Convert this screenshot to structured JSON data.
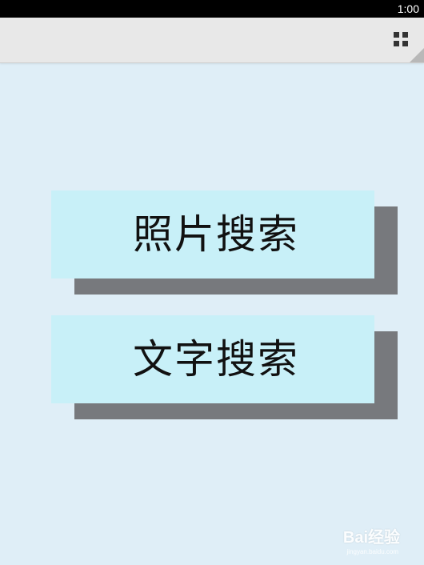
{
  "status_bar": {
    "time": "1:00"
  },
  "action_bar": {
    "menu_icon": "grid-menu-icon"
  },
  "buttons": [
    {
      "label": "照片搜索"
    },
    {
      "label": "文字搜索"
    }
  ],
  "watermark": {
    "text": "Bai经验",
    "subtext": "jingyan.baidu.com"
  },
  "colors": {
    "background": "#dfeef7",
    "button_face": "#c8f0f8",
    "button_shadow": "#77797d",
    "status_bar": "#000000",
    "action_bar": "#e8e8e8"
  }
}
